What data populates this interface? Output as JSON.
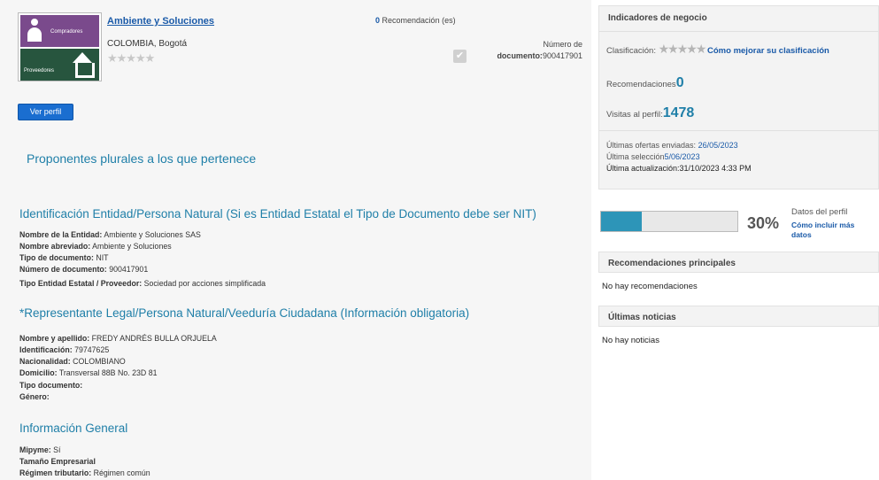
{
  "header": {
    "logo_top_text": "Compradores",
    "logo_bottom_text": "Proveedores",
    "company_name": "Ambiente y Soluciones",
    "location": "COLOMBIA, Bogotá",
    "rating_stars": "★★★★★",
    "recommendations_count": "0",
    "recommendations_label": "Recomendación (es)",
    "doc_number_label_1": "Número de",
    "doc_number_label_2": "documento:",
    "doc_number_value": "900417901",
    "check_glyph": "✔"
  },
  "ver_perfil_label": "Ver perfil",
  "plural_proponents_title": "Proponentes plurales a los que pertenece",
  "identificacion": {
    "title": "Identificación Entidad/Persona Natural (Si es Entidad Estatal el Tipo de Documento debe ser NIT)",
    "fields": [
      {
        "label": "Nombre de la Entidad:",
        "value": "Ambiente y Soluciones SAS"
      },
      {
        "label": "Nombre abreviado:",
        "value": "Ambiente y Soluciones"
      },
      {
        "label": "Tipo de documento:",
        "value": "NIT"
      },
      {
        "label": "Número de documento:",
        "value": "900417901"
      },
      {
        "label": "Tipo Entidad Estatal / Proveedor:",
        "value": "Sociedad por acciones simplificada"
      }
    ]
  },
  "representante": {
    "title": "*Representante Legal/Persona Natural/Veeduría Ciudadana (Información obligatoria)",
    "fields": [
      {
        "label": "Nombre y apellido:",
        "value": "FREDY ANDRÉS BULLA ORJUELA"
      },
      {
        "label": "Identificación:",
        "value": "79747625"
      },
      {
        "label": "Nacionalidad:",
        "value": "COLOMBIANO"
      },
      {
        "label": "Domicilio:",
        "value": "Transversal 88B No. 23D 81"
      },
      {
        "label": "Tipo documento:",
        "value": ""
      },
      {
        "label": "Género:",
        "value": ""
      }
    ]
  },
  "informacion_general": {
    "title": "Información General",
    "fields": [
      {
        "label": "Mipyme:",
        "value": "Sí"
      },
      {
        "label": "Tamaño Empresarial",
        "value": ""
      },
      {
        "label": "Régimen tributario:",
        "value": "Régimen común"
      }
    ]
  },
  "indicadores": {
    "title": "Indicadores de negocio",
    "clasificacion_label": "Clasificación:",
    "clasificacion_stars": "★★★★★",
    "mejorar_link": "Cómo mejorar su clasificación",
    "recomendaciones_label": "Recomendaciones",
    "recomendaciones_value": "0",
    "visitas_label": "Visitas al perfil:",
    "visitas_value": "1478",
    "ultimas_ofertas_label": "Últimas ofertas enviadas:",
    "ultimas_ofertas_value": "26/05/2023",
    "ultima_seleccion_label": "Última selección",
    "ultima_seleccion_value": "5/06/2023",
    "ultima_actualizacion_label": "Última actualización:",
    "ultima_actualizacion_value": "31/10/2023 4:33 PM"
  },
  "datos_perfil": {
    "percent": 30,
    "percent_label": "30%",
    "label": "Datos del perfil",
    "link": "Cómo incluir más datos"
  },
  "recomendaciones_principales": {
    "title": "Recomendaciones principales",
    "empty_text": "No hay recomendaciones"
  },
  "ultimas_noticias": {
    "title": "Últimas noticias",
    "empty_text": "No hay noticias"
  }
}
